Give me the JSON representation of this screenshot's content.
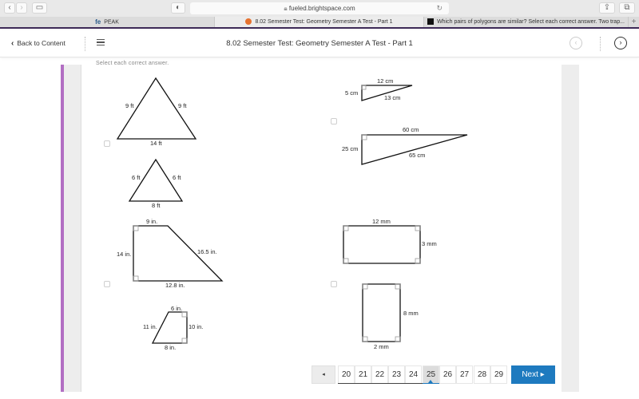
{
  "browser": {
    "url": "fueled.brightspace.com",
    "tabs": [
      {
        "label": "PEAK",
        "icon": "fe-logo-icon",
        "active": false
      },
      {
        "label": "8.02 Semester Test: Geometry Semester A Test - Part 1",
        "icon": "brightspace-icon",
        "active": true
      },
      {
        "label": "Which pairs of polygons are similar? Select each correct answer. Two trap...",
        "icon": "brainly-icon",
        "active": false
      }
    ],
    "new_tab_label": "+"
  },
  "header": {
    "back_label": "Back to Content",
    "title": "8.02 Semester Test: Geometry Semester A Test - Part 1"
  },
  "question": {
    "instruction": "Select each correct answer.",
    "options": [
      {
        "checked": false,
        "shape_a": {
          "type": "triangle",
          "labels": {
            "left": "9 ft",
            "right": "9 ft",
            "bottom": "14 ft"
          }
        },
        "shape_b": {
          "type": "triangle",
          "labels": {
            "left": "6 ft",
            "right": "6 ft",
            "bottom": "8 ft"
          }
        }
      },
      {
        "checked": false,
        "shape_a": {
          "type": "right-triangle",
          "labels": {
            "top": "12 cm",
            "left": "5 cm",
            "hyp": "13 cm"
          }
        },
        "shape_b": {
          "type": "right-triangle",
          "labels": {
            "top": "60 cm",
            "left": "25 cm",
            "hyp": "65 cm"
          }
        }
      },
      {
        "checked": false,
        "shape_a": {
          "type": "trapezoid",
          "labels": {
            "top": "9 in.",
            "left": "14 in.",
            "slant": "16.5 in.",
            "bottom": "12.8 in."
          }
        },
        "shape_b": {
          "type": "trapezoid",
          "labels": {
            "top": "6 in.",
            "slant": "11 in.",
            "right": "10 in.",
            "bottom": "8 in."
          }
        }
      },
      {
        "checked": false,
        "shape_a": {
          "type": "rectangle",
          "labels": {
            "top": "12 mm",
            "right": "3 mm"
          }
        },
        "shape_b": {
          "type": "rectangle",
          "labels": {
            "right": "8 mm",
            "bottom": "2 mm"
          }
        }
      }
    ]
  },
  "pagination": {
    "prev_label": "◂",
    "pages": [
      "20",
      "21",
      "22",
      "23",
      "24",
      "25",
      "26",
      "27",
      "28",
      "29"
    ],
    "current": "25",
    "next_label": "Next ▸"
  }
}
